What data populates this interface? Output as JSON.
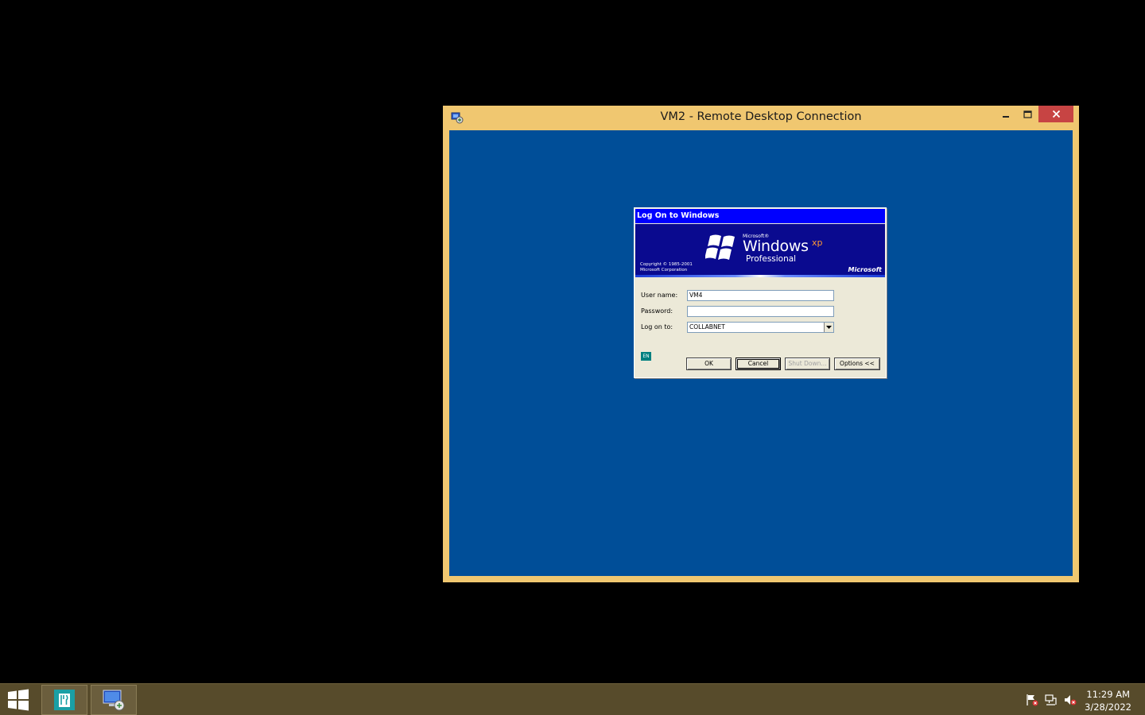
{
  "rdp_window": {
    "title": "VM2 - Remote Desktop Connection",
    "frame_color": "#f0c770",
    "desktop_color": "#004e98"
  },
  "logon_dialog": {
    "title": "Log On to Windows",
    "banner": {
      "microsoft_small": "Microsoft®",
      "windows": "Windows",
      "xp": "xp",
      "edition": "Professional",
      "copyright_line1": "Copyright © 1985-2001",
      "copyright_line2": "Microsoft Corporation",
      "brand": "Microsoft"
    },
    "fields": {
      "username_label": "User name:",
      "username_value": "VM4",
      "password_label": "Password:",
      "password_value": "",
      "logon_to_label": "Log on to:",
      "logon_to_value": "COLLABNET"
    },
    "language_indicator": "EN",
    "buttons": {
      "ok": "OK",
      "cancel": "Cancel",
      "shutdown": "Shut Down...",
      "options": "Options <<"
    }
  },
  "taskbar": {
    "apps": [
      {
        "icon": "restaurant-app-icon"
      },
      {
        "icon": "remote-desktop-icon"
      }
    ],
    "tray": [
      "action-center-flag-icon",
      "network-icon",
      "volume-muted-icon"
    ],
    "clock": {
      "time": "11:29 AM",
      "date": "3/28/2022"
    },
    "color": "#574b2b"
  }
}
